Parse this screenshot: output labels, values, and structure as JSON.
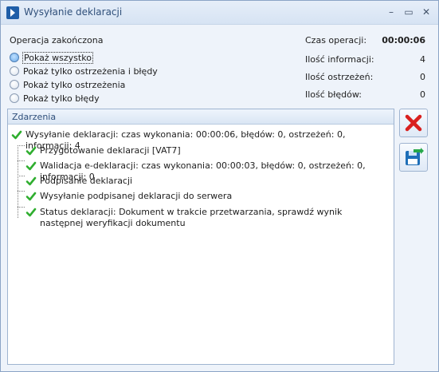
{
  "window": {
    "title": "Wysyłanie deklaracji"
  },
  "titlebar": {
    "minimize_glyph": "–",
    "maximize_glyph": "▭",
    "close_glyph": "✕"
  },
  "status": {
    "operation_state": "Operacja zakończona"
  },
  "filters": [
    {
      "label": "Pokaż wszystko",
      "selected": true
    },
    {
      "label": "Pokaż tylko ostrzeżenia i błędy",
      "selected": false
    },
    {
      "label": "Pokaż tylko ostrzeżenia",
      "selected": false
    },
    {
      "label": "Pokaż tylko błędy",
      "selected": false
    }
  ],
  "stats": {
    "time_label": "Czas operacji:",
    "time_value": "00:00:06",
    "info_label": "Ilość informacji:",
    "info_value": "4",
    "warn_label": "Ilość ostrzeżeń:",
    "warn_value": "0",
    "err_label": "Ilość błędów:",
    "err_value": "0"
  },
  "events": {
    "header": "Zdarzenia",
    "root": "Wysyłanie deklaracji: czas wykonania: 00:00:06, błędów: 0, ostrzeżeń: 0, informacji: 4",
    "children": [
      "Przygotowanie deklaracji [VAT7]",
      "Walidacja e-deklaracji: czas wykonania: 00:00:03, błędów: 0, ostrzeżeń: 0, informacji: 0",
      "Podpisanie deklaracji",
      "Wysyłanie podpisanej deklaracji do serwera",
      "Status deklaracji: Dokument w trakcie przetwarzania, sprawdź wynik następnej weryfikacji dokumentu"
    ]
  },
  "icons": {
    "close_action": "red-x-icon",
    "save_action": "save-diskette-icon",
    "check": "green-check-icon"
  },
  "colors": {
    "accent": "#1f5ea8",
    "check": "#2fae2f",
    "cancel": "#d9201f"
  }
}
